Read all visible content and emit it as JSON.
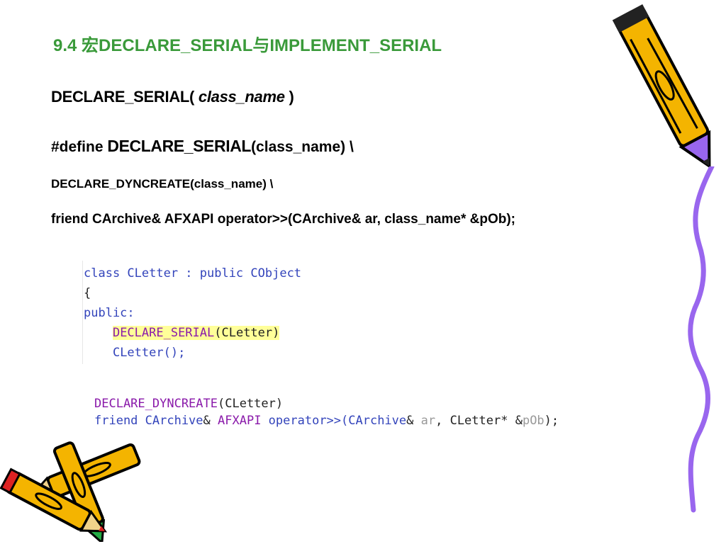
{
  "title": "9.4 宏DECLARE_SERIAL与IMPLEMENT_SERIAL",
  "syntax": {
    "prefix": "DECLARE_SERIAL( ",
    "arg": "class_name",
    "suffix": " )"
  },
  "define": {
    "prefix": "#define ",
    "macro": "DECLARE_SERIAL",
    "rest": "(class_name) \\"
  },
  "dyncreate_line": "DECLARE_DYNCREATE(class_name) \\",
  "friend_line": "friend CArchive& AFXAPI operator>>(CArchive& ar, class_name* &pOb);",
  "code1": {
    "line1": "class CLetter : public CObject",
    "line2": "{",
    "line3": "public:",
    "line4_macro": "DECLARE_SERIAL",
    "line4_args": "(CLetter)",
    "line5": "CLetter();"
  },
  "code2": {
    "l1_macro": "DECLARE_DYNCREATE",
    "l1_args": "(CLetter)",
    "l2_a": "friend CArchive",
    "l2_amp1": "& ",
    "l2_afx": "AFXAPI",
    "l2_b": " operator>>(CArchive",
    "l2_amp2": "& ",
    "l2_ar": "ar",
    "l2_c": ", CLetter",
    "l2_star": "* &",
    "l2_pob": "pOb",
    "l2_end": ");"
  },
  "colors": {
    "title": "#3a9a3a",
    "code_keyword": "#3344bb",
    "macro": "#8a1aaa",
    "highlight": "#ffff99",
    "purple_line": "#9966ee",
    "pencil_yellow": "#f4b400"
  },
  "icons": [
    "pencil-icon",
    "crossed-pencils-icon",
    "wavy-line-decoration"
  ]
}
